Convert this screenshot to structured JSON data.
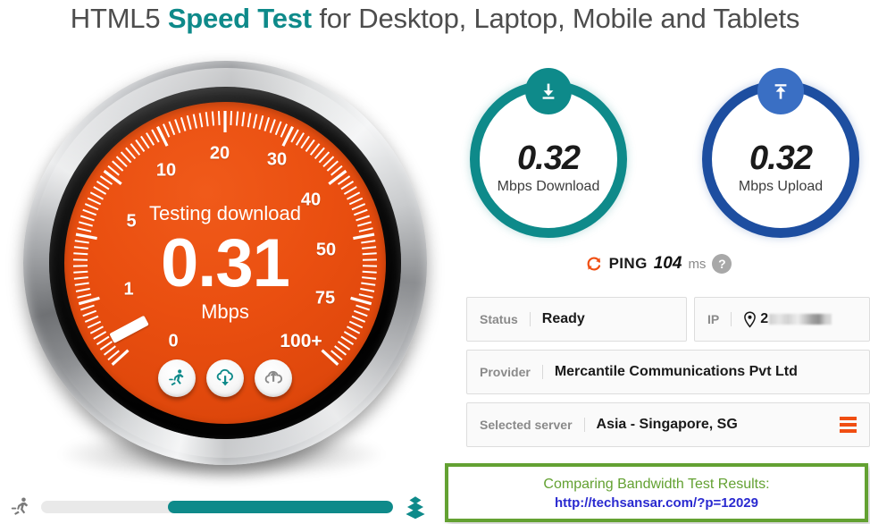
{
  "header": {
    "title_part1": "HTML5 ",
    "title_brand": "Speed Test",
    "title_part2": " for Desktop, Laptop, Mobile and Tablets"
  },
  "gauge": {
    "status_label": "Testing download",
    "value": "0.31",
    "unit": "Mbps",
    "scale_labels": [
      "0",
      "1",
      "5",
      "10",
      "20",
      "30",
      "40",
      "50",
      "75",
      "100+"
    ],
    "buttons": [
      {
        "name": "start-test",
        "icon": "runner-icon"
      },
      {
        "name": "download-test",
        "icon": "cloud-download-icon"
      },
      {
        "name": "upload-test",
        "icon": "cloud-upload-icon"
      }
    ]
  },
  "progress": {
    "icon": "runner-icon",
    "percent": 64,
    "end_icon": "layers-icon"
  },
  "results": {
    "download": {
      "value": "0.32",
      "unit": "Mbps Download",
      "icon": "download-arrow-icon",
      "color": "#0e8a8a"
    },
    "upload": {
      "value": "0.32",
      "unit": "Mbps Upload",
      "icon": "upload-arrow-icon",
      "color": "#1d4ea0"
    },
    "ping": {
      "icon": "refresh-icon",
      "label": "PING",
      "value": "104",
      "unit": "ms",
      "help": "?"
    }
  },
  "info": {
    "status_key": "Status",
    "status_value": "Ready",
    "ip_key": "IP",
    "ip_value": "2",
    "provider_key": "Provider",
    "provider_value": "Mercantile Communications Pvt Ltd",
    "server_key": "Selected server",
    "server_value": "Asia - Singapore, SG",
    "server_menu_icon": "hamburger-icon"
  },
  "promo": {
    "title": "Comparing Bandwidth Test Results:",
    "link": "http://techsansar.com/?p=12029",
    "border_color": "#63a132",
    "link_color": "#2a2ad0"
  },
  "chart_data": {
    "type": "gauge",
    "title": "Testing download",
    "value": 0.31,
    "unit": "Mbps",
    "tick_labels": [
      "0",
      "1",
      "5",
      "10",
      "20",
      "30",
      "40",
      "50",
      "75",
      "100+"
    ],
    "needle_angle_deg": -28,
    "min": 0,
    "max": 100
  }
}
